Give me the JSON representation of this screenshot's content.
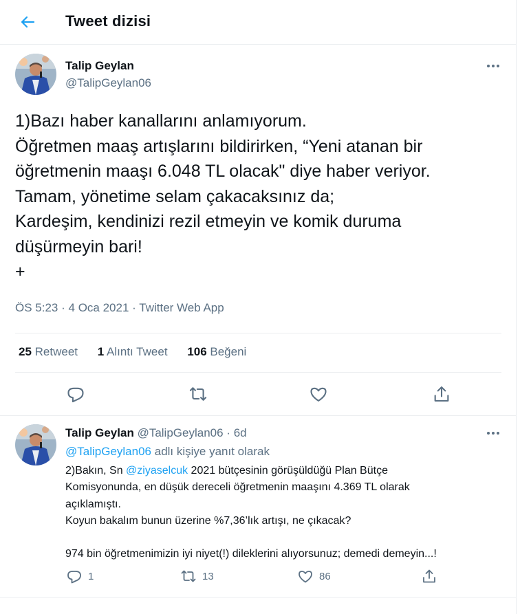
{
  "header": {
    "title": "Tweet dizisi",
    "back_icon": "arrow-left-icon"
  },
  "colors": {
    "accent": "#1da1f2",
    "text": "#0f1419",
    "muted": "#5b7083",
    "border": "#ebeef0"
  },
  "main_tweet": {
    "author_name": "Talip Geylan",
    "author_handle": "@TalipGeylan06",
    "lines": [
      "1)Bazı haber kanallarını anlamıyorum.",
      "Öğretmen maaş artışlarını bildirirken, “Yeni atanan bir",
      "öğretmenin maaşı 6.048 TL olacak\" diye haber veriyor.",
      "Tamam, yönetime selam çakacaksınız da;",
      "Kardeşim, kendinizi rezil etmeyin ve komik duruma",
      "düşürmeyin bari!",
      "+"
    ],
    "time": "ÖS 5:23",
    "date": "4 Oca 2021",
    "source": "Twitter Web App",
    "dot": "·",
    "stats": {
      "retweets_count": "25",
      "retweets_label": "Retweet",
      "quotes_count": "1",
      "quotes_label": "Alıntı Tweet",
      "likes_count": "106",
      "likes_label": "Beğeni"
    },
    "actions": [
      "reply-icon",
      "retweet-icon",
      "like-icon",
      "share-icon"
    ]
  },
  "reply_tweet": {
    "author_name": "Talip Geylan",
    "author_handle": "@TalipGeylan06",
    "dot": "·",
    "age": "6d",
    "reply_to_handle": "@TalipGeylan06",
    "reply_to_suffix": "adlı kişiye yanıt olarak",
    "line1_prefix": "2)Bakın, Sn ",
    "line1_mention": "@ziyaselcuk",
    "line1_suffix": " 2021 bütçesinin görüşüldüğü Plan Bütçe",
    "lines": [
      "Komisyonunda, en düşük dereceli öğretmenin maaşını 4.369 TL olarak",
      "açıklamıştı.",
      "Koyun bakalım bunun üzerine %7,36’lık artışı, ne çıkacak?",
      "",
      "974 bin öğretmenimizin iyi niyet(!) dileklerini alıyorsunuz; demedi demeyin...!"
    ],
    "reply_count": "1",
    "retweet_count": "13",
    "like_count": "86"
  }
}
